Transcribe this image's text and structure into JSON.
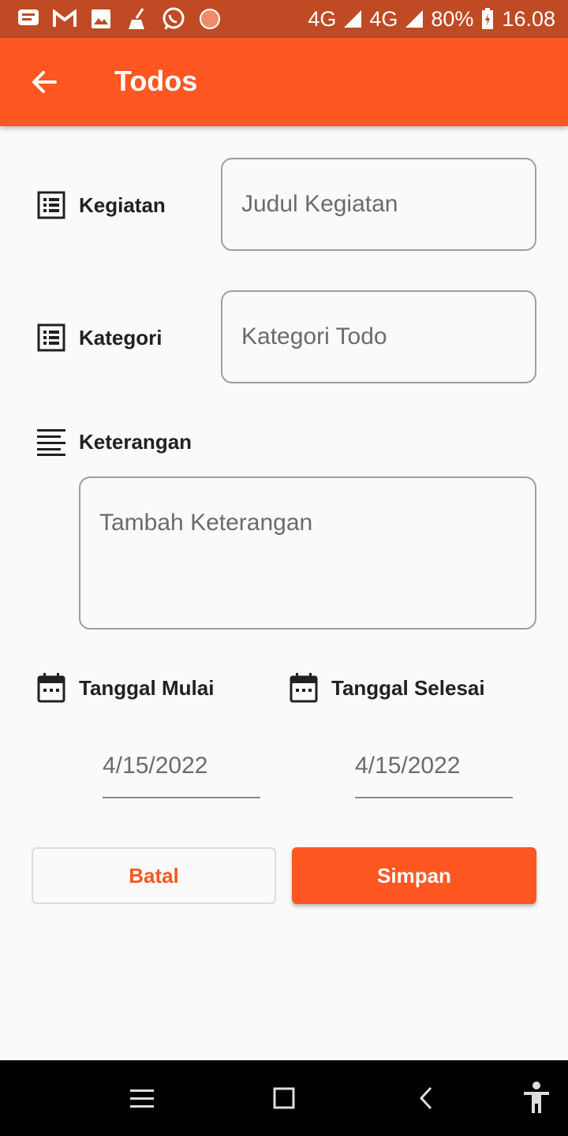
{
  "status_bar": {
    "network_1": "4G",
    "network_2": "4G",
    "battery": "80%",
    "time": "16.08",
    "icons": [
      "message-icon",
      "gmail-icon",
      "gallery-icon",
      "cleaner-icon",
      "whatsapp-icon",
      "app-icon"
    ]
  },
  "app_bar": {
    "title": "Todos",
    "back_icon": "arrow-back-icon"
  },
  "form": {
    "kegiatan": {
      "label": "Kegiatan",
      "placeholder": "Judul Kegiatan",
      "value": ""
    },
    "kategori": {
      "label": "Kategori",
      "placeholder": "Kategori Todo",
      "value": ""
    },
    "keterangan": {
      "label": "Keterangan",
      "placeholder": "Tambah Keterangan",
      "value": ""
    },
    "tanggal_mulai": {
      "label": "Tanggal Mulai",
      "value": "4/15/2022"
    },
    "tanggal_selesai": {
      "label": "Tanggal Selesai",
      "value": "4/15/2022"
    }
  },
  "actions": {
    "cancel_label": "Batal",
    "save_label": "Simpan"
  },
  "colors": {
    "accent": "#ff5722",
    "status_bar": "#bf4a23",
    "background": "#fafafa"
  },
  "nav_bar": {
    "icons": [
      "menu-icon",
      "home-square-icon",
      "back-chevron-icon",
      "accessibility-icon"
    ]
  }
}
